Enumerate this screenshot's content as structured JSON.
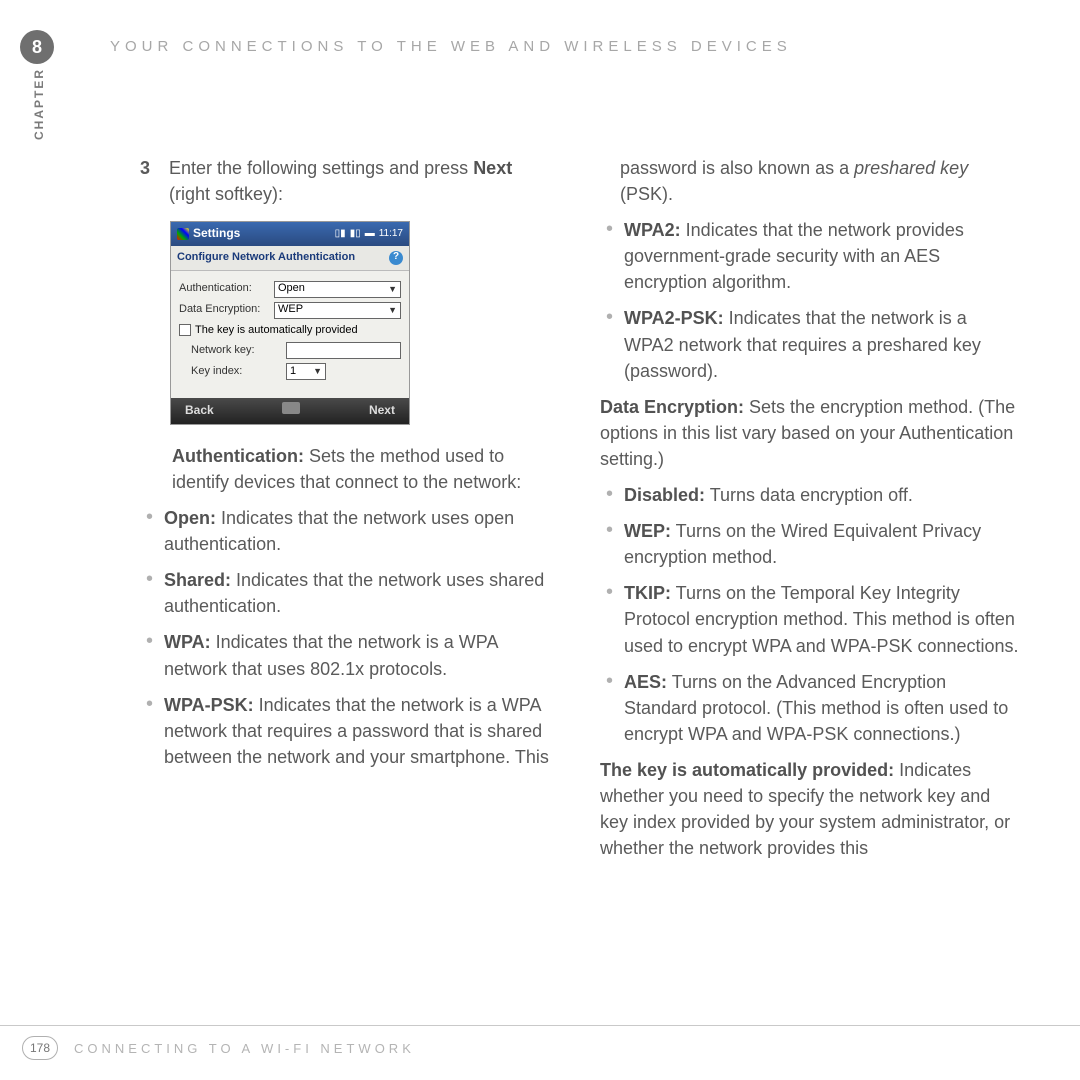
{
  "chapter_number": "8",
  "chapter_label": "CHAPTER",
  "header_title": "YOUR CONNECTIONS TO THE WEB AND WIRELESS DEVICES",
  "step": {
    "num": "3",
    "text_before_bold": "Enter the following settings and press ",
    "bold": "Next",
    "text_after_bold": " (right softkey):"
  },
  "screenshot": {
    "titlebar": "Settings",
    "time": "11:17",
    "subtitle": "Configure Network Authentication",
    "auth_label": "Authentication:",
    "auth_value": "Open",
    "enc_label": "Data Encryption:",
    "enc_value": "WEP",
    "checkbox_label": "The key is automatically provided",
    "netkey_label": "Network key:",
    "netkey_value": "",
    "keyidx_label": "Key index:",
    "keyidx_value": "1",
    "soft_left": "Back",
    "soft_right": "Next"
  },
  "col1": {
    "auth_heading": "Authentication:",
    "auth_text": " Sets the method used to identify devices that connect to the network:",
    "items": [
      {
        "b": "Open:",
        "t": " Indicates that the network uses open authentication."
      },
      {
        "b": "Shared:",
        "t": " Indicates that the network uses shared authentication."
      },
      {
        "b": "WPA:",
        "t": " Indicates that the network is a WPA network that uses 802.1x protocols."
      },
      {
        "b": "WPA-PSK:",
        "t": " Indicates that the network is a WPA network that requires a password that is shared between the network and your smartphone. This"
      }
    ]
  },
  "col2": {
    "cont_text_1": "password is also known as a ",
    "cont_italic": "preshared key",
    "cont_text_2": " (PSK).",
    "items_top": [
      {
        "b": "WPA2:",
        "t": " Indicates that the network provides government-grade security with an AES encryption algorithm."
      },
      {
        "b": "WPA2-PSK:",
        "t": " Indicates that the network is a WPA2 network that requires a preshared key (password)."
      }
    ],
    "enc_heading": "Data Encryption:",
    "enc_text": " Sets the encryption method. (The options in this list vary based on your Authentication setting.)",
    "items_enc": [
      {
        "b": "Disabled:",
        "t": " Turns data encryption off."
      },
      {
        "b": "WEP:",
        "t": " Turns on the Wired Equivalent Privacy encryption method."
      },
      {
        "b": "TKIP:",
        "t": " Turns on the Temporal Key Integrity Protocol encryption method. This method is often used to encrypt WPA and WPA-PSK connections."
      },
      {
        "b": "AES:",
        "t": " Turns on the Advanced Encryption Standard protocol. (This method is often used to encrypt WPA and WPA-PSK connections.)"
      }
    ],
    "key_heading": "The key is automatically provided:",
    "key_text": " Indicates whether you need to specify the network key and key index provided by your system administrator, or whether the network provides this"
  },
  "footer": {
    "page": "178",
    "title": "CONNECTING TO A WI-FI NETWORK"
  }
}
